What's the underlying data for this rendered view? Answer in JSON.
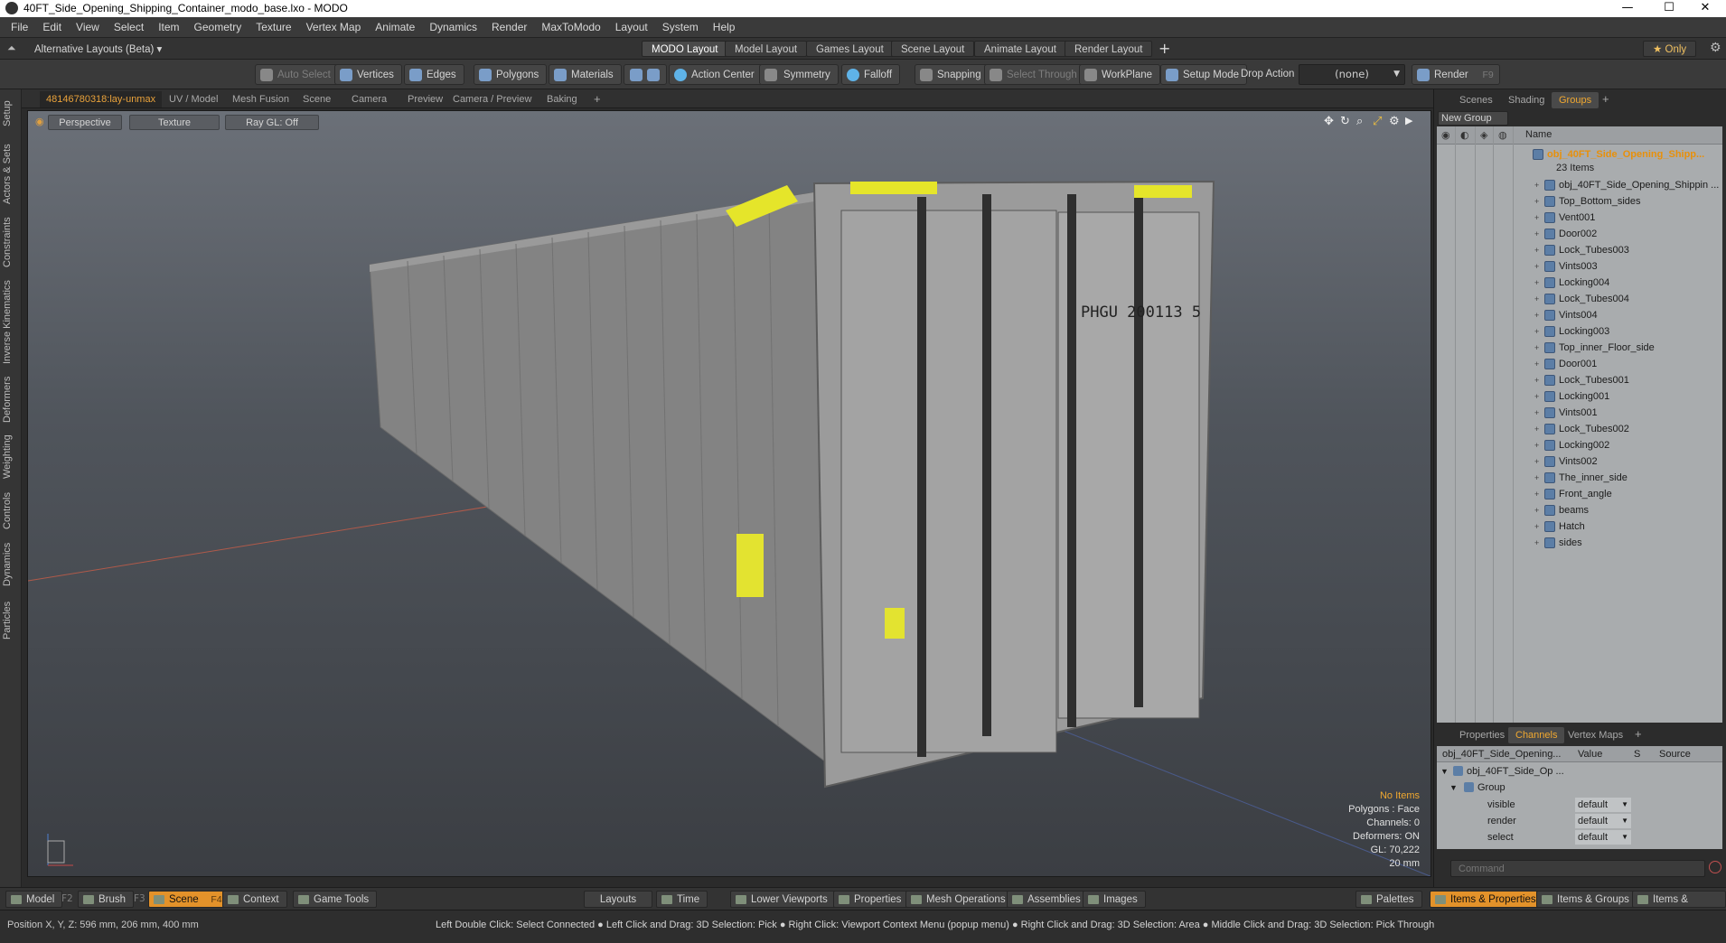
{
  "window": {
    "title": "40FT_Side_Opening_Shipping_Container_modo_base.lxo - MODO",
    "minimize": "—",
    "maximize": "☐",
    "close": "✕"
  },
  "menu": [
    "File",
    "Edit",
    "View",
    "Select",
    "Item",
    "Geometry",
    "Texture",
    "Vertex Map",
    "Animate",
    "Dynamics",
    "Render",
    "MaxToModo",
    "Layout",
    "System",
    "Help"
  ],
  "layoutbar": {
    "alt_layouts": "Alternative Layouts (Beta) ▾",
    "tabs": [
      "MODO Layout",
      "Model Layout",
      "Games Layout",
      "Scene Layout",
      "Animate Layout",
      "Render Layout"
    ],
    "add": "+",
    "only": "★ Only"
  },
  "toolbar": {
    "auto_select": "Auto Select",
    "vertices": "Vertices",
    "edges": "Edges",
    "polygons": "Polygons",
    "materials": "Materials",
    "action_center": "Action Center",
    "symmetry": "Symmetry",
    "falloff": "Falloff",
    "snapping": "Snapping",
    "select_through": "Select Through",
    "workplane": "WorkPlane",
    "setup_mode": "Setup Mode",
    "drop_action": "Drop Action",
    "drop_value": "(none)",
    "render": "Render",
    "render_key": "F9"
  },
  "lefttabs": [
    "Setup",
    "Actors & Sets",
    "Constraints",
    "Inverse Kinematics",
    "Deformers",
    "Weighting",
    "Controls",
    "Dynamics",
    "Particles"
  ],
  "vptabs": [
    "48146780318:lay-unmax",
    "UV / Model",
    "Mesh Fusion",
    "Scene",
    "Camera",
    "Preview",
    "Camera / Preview",
    "Baking",
    "+"
  ],
  "viewport": {
    "perspective": "Perspective",
    "texture": "Texture",
    "raygl": "Ray GL: Off",
    "container_text": "PHGU 200113 5",
    "info": [
      "No Items",
      "Polygons : Face",
      "Channels: 0",
      "Deformers: ON",
      "GL: 70,222",
      "20 mm"
    ]
  },
  "rpanel": {
    "tabs": [
      "Scenes",
      "Shading",
      "Groups",
      "+"
    ],
    "new_group": "New Group",
    "name_col": "Name",
    "root": "obj_40FT_Side_Opening_Shipp...",
    "count": "23 Items",
    "items": [
      "obj_40FT_Side_Opening_Shippin ...",
      "Top_Bottom_sides",
      "Vent001",
      "Door002",
      "Lock_Tubes003",
      "Vints003",
      "Locking004",
      "Lock_Tubes004",
      "Vints004",
      "Locking003",
      "Top_inner_Floor_side",
      "Door001",
      "Lock_Tubes001",
      "Locking001",
      "Vints001",
      "Lock_Tubes002",
      "Locking002",
      "Vints002",
      "The_inner_side",
      "Front_angle",
      "beams",
      "Hatch",
      "sides"
    ]
  },
  "channels": {
    "tabs": [
      "Properties",
      "Channels",
      "Vertex Maps",
      "+"
    ],
    "head_name": "obj_40FT_Side_Opening...",
    "head_value": "Value",
    "head_s": "S",
    "head_source": "Source",
    "obj": "obj_40FT_Side_Op ...",
    "group": "Group",
    "rows": [
      {
        "name": "visible",
        "value": "default"
      },
      {
        "name": "render",
        "value": "default"
      },
      {
        "name": "select",
        "value": "default"
      }
    ],
    "command_placeholder": "Command"
  },
  "bottombar": {
    "model": "Model",
    "model_key": "F2",
    "brush": "Brush",
    "brush_key": "F3",
    "scene": "Scene",
    "scene_key": "F4",
    "context": "Context",
    "game_tools": "Game Tools",
    "layouts": "Layouts",
    "time": "Time",
    "lower_viewports": "Lower Viewports",
    "properties": "Properties",
    "mesh_operations": "Mesh Operations",
    "assemblies": "Assemblies",
    "images": "Images",
    "palettes": "Palettes",
    "items_properties": "Items & Properties",
    "items_groups": "Items & Groups",
    "items_shading": "Items & Shading"
  },
  "status": {
    "position": "Position X, Y, Z:   596 mm, 206 mm, 400 mm",
    "hints": "Left Double Click: Select Connected ● Left Click and Drag: 3D Selection: Pick ● Right Click: Viewport Context Menu (popup menu) ● Right Click and Drag: 3D Selection: Area ● Middle Click and Drag: 3D Selection: Pick Through"
  },
  "colors": {
    "accent": "#e3922a",
    "mesh_icon": "#5c7ea6",
    "panel_bg": "#a9acae"
  }
}
